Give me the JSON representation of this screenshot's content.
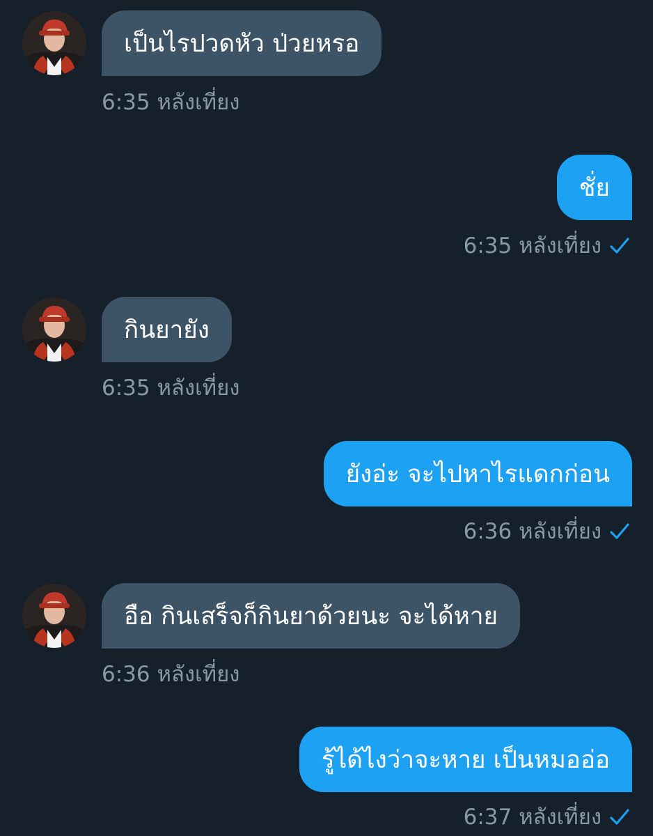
{
  "colors": {
    "background": "#15202b",
    "incoming_bubble": "#3d5466",
    "outgoing_bubble": "#1da1f2",
    "timestamp": "#8899a6",
    "read_check": "#1da1f2"
  },
  "icons": {
    "avatar": "user-avatar",
    "read_receipt": "checkmark-icon"
  },
  "messages": [
    {
      "direction": "in",
      "text": "เป็นไรปวดหัว ป่วยหรอ",
      "time": "6:35 หลังเที่ยง"
    },
    {
      "direction": "out",
      "text": "ชั่ย",
      "time": "6:35 หลังเที่ยง"
    },
    {
      "direction": "in",
      "text": "กินยายัง",
      "time": "6:35 หลังเที่ยง"
    },
    {
      "direction": "out",
      "text": "ยังอ่ะ จะไปหาไรแดกก่อน",
      "time": "6:36 หลังเที่ยง"
    },
    {
      "direction": "in",
      "text": "อือ กินเสร็จก็กินยาด้วยนะ จะได้หาย",
      "time": "6:36 หลังเที่ยง"
    },
    {
      "direction": "out",
      "text": "รู้ได้ไงว่าจะหาย เป็นหมออ่อ",
      "time": "6:37 หลังเที่ยง"
    }
  ]
}
